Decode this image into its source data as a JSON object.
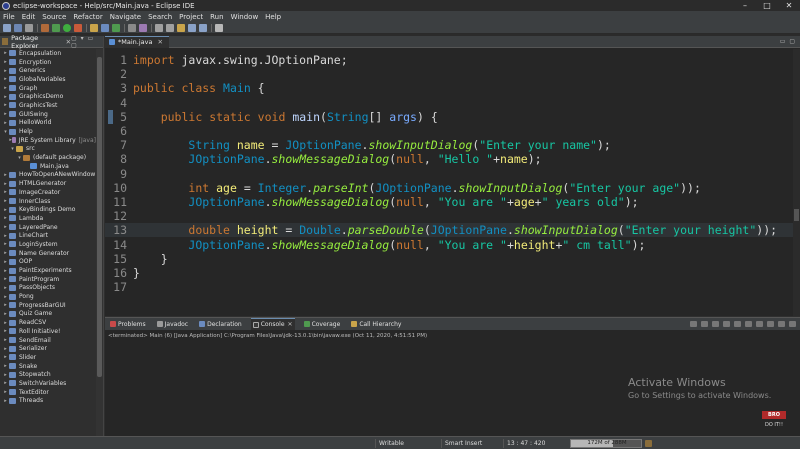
{
  "window": {
    "title": "eclipse-workspace - Help/src/Main.java - Eclipse IDE",
    "controls": [
      "–",
      "□",
      "✕"
    ]
  },
  "menu": [
    "File",
    "Edit",
    "Source",
    "Refactor",
    "Navigate",
    "Search",
    "Project",
    "Run",
    "Window",
    "Help"
  ],
  "package_explorer": {
    "title": "Package Explorer",
    "close": "✕",
    "tree": [
      {
        "label": "Encapsulation",
        "indent": 0,
        "arrow": "▸",
        "kind": "project"
      },
      {
        "label": "Encryption",
        "indent": 0,
        "arrow": "▸",
        "kind": "project"
      },
      {
        "label": "Generics",
        "indent": 0,
        "arrow": "▸",
        "kind": "project"
      },
      {
        "label": "GlobalVariables",
        "indent": 0,
        "arrow": "▸",
        "kind": "project"
      },
      {
        "label": "Graph",
        "indent": 0,
        "arrow": "▸",
        "kind": "project"
      },
      {
        "label": "GraphicsDemo",
        "indent": 0,
        "arrow": "▸",
        "kind": "project"
      },
      {
        "label": "GraphicsTest",
        "indent": 0,
        "arrow": "▸",
        "kind": "project"
      },
      {
        "label": "GUISwing",
        "indent": 0,
        "arrow": "▸",
        "kind": "project"
      },
      {
        "label": "HelloWorld",
        "indent": 0,
        "arrow": "▸",
        "kind": "project"
      },
      {
        "label": "Help",
        "indent": 0,
        "arrow": "▾",
        "kind": "project"
      },
      {
        "label": "JRE System Library",
        "sub": "[Java]",
        "indent": 1,
        "arrow": "▸",
        "kind": "library"
      },
      {
        "label": "src",
        "indent": 1,
        "arrow": "▾",
        "kind": "folder"
      },
      {
        "label": "(default package)",
        "indent": 2,
        "arrow": "▾",
        "kind": "package"
      },
      {
        "label": "Main.java",
        "indent": 3,
        "arrow": "",
        "kind": "java"
      },
      {
        "label": "HowToOpenANewWindow",
        "indent": 0,
        "arrow": "▸",
        "kind": "project"
      },
      {
        "label": "HTMLGenerator",
        "indent": 0,
        "arrow": "▸",
        "kind": "project"
      },
      {
        "label": "ImageCreator",
        "indent": 0,
        "arrow": "▸",
        "kind": "project"
      },
      {
        "label": "InnerClass",
        "indent": 0,
        "arrow": "▸",
        "kind": "project"
      },
      {
        "label": "KeyBindings Demo",
        "indent": 0,
        "arrow": "▸",
        "kind": "project"
      },
      {
        "label": "Lambda",
        "indent": 0,
        "arrow": "▸",
        "kind": "project"
      },
      {
        "label": "LayeredPane",
        "indent": 0,
        "arrow": "▸",
        "kind": "project"
      },
      {
        "label": "LineChart",
        "indent": 0,
        "arrow": "▸",
        "kind": "project"
      },
      {
        "label": "LoginSystem",
        "indent": 0,
        "arrow": "▸",
        "kind": "project"
      },
      {
        "label": "Name Generator",
        "indent": 0,
        "arrow": "▸",
        "kind": "project"
      },
      {
        "label": "OOP",
        "indent": 0,
        "arrow": "▸",
        "kind": "project"
      },
      {
        "label": "PaintExperiments",
        "indent": 0,
        "arrow": "▸",
        "kind": "project"
      },
      {
        "label": "PaintProgram",
        "indent": 0,
        "arrow": "▸",
        "kind": "project"
      },
      {
        "label": "PassObjects",
        "indent": 0,
        "arrow": "▸",
        "kind": "project"
      },
      {
        "label": "Pong",
        "indent": 0,
        "arrow": "▸",
        "kind": "project"
      },
      {
        "label": "ProgressBarGUI",
        "indent": 0,
        "arrow": "▸",
        "kind": "project"
      },
      {
        "label": "Quiz Game",
        "indent": 0,
        "arrow": "▸",
        "kind": "project"
      },
      {
        "label": "ReadCSV",
        "indent": 0,
        "arrow": "▸",
        "kind": "project"
      },
      {
        "label": "Roll Initiative!",
        "indent": 0,
        "arrow": "▸",
        "kind": "project"
      },
      {
        "label": "SendEmail",
        "indent": 0,
        "arrow": "▸",
        "kind": "project"
      },
      {
        "label": "Serializer",
        "indent": 0,
        "arrow": "▸",
        "kind": "project"
      },
      {
        "label": "Slider",
        "indent": 0,
        "arrow": "▸",
        "kind": "project"
      },
      {
        "label": "Snake",
        "indent": 0,
        "arrow": "▸",
        "kind": "project"
      },
      {
        "label": "Stopwatch",
        "indent": 0,
        "arrow": "▸",
        "kind": "project"
      },
      {
        "label": "SwitchVariables",
        "indent": 0,
        "arrow": "▸",
        "kind": "project"
      },
      {
        "label": "TextEditor",
        "indent": 0,
        "arrow": "▸",
        "kind": "project"
      },
      {
        "label": "Threads",
        "indent": 0,
        "arrow": "▸",
        "kind": "project"
      }
    ]
  },
  "editor": {
    "tab_label": "*Main.java",
    "tab_close": "✕",
    "current_line": 13,
    "lines": [
      {
        "n": "1",
        "tokens": [
          [
            "kw",
            "import"
          ],
          [
            "pl",
            " javax.swing.JOptionPane;"
          ]
        ]
      },
      {
        "n": "2",
        "tokens": []
      },
      {
        "n": "3",
        "tokens": [
          [
            "kw",
            "public"
          ],
          [
            "pl",
            " "
          ],
          [
            "kw",
            "class"
          ],
          [
            "pl",
            " "
          ],
          [
            "cl",
            "Main"
          ],
          [
            "pl",
            " {"
          ]
        ]
      },
      {
        "n": "4",
        "tokens": []
      },
      {
        "n": "5",
        "tokens": [
          [
            "pl",
            "    "
          ],
          [
            "kw",
            "public"
          ],
          [
            "pl",
            " "
          ],
          [
            "kw",
            "static"
          ],
          [
            "pl",
            " "
          ],
          [
            "kw",
            "void"
          ],
          [
            "pl",
            " "
          ],
          [
            "fn",
            "main"
          ],
          [
            "pl",
            "("
          ],
          [
            "cl",
            "String"
          ],
          [
            "pl",
            "[] "
          ],
          [
            "vb",
            "args"
          ],
          [
            "pl",
            ") {"
          ]
        ]
      },
      {
        "n": "6",
        "tokens": []
      },
      {
        "n": "7",
        "tokens": [
          [
            "pl",
            "        "
          ],
          [
            "cl",
            "String"
          ],
          [
            "pl",
            " "
          ],
          [
            "va",
            "name"
          ],
          [
            "pl",
            " = "
          ],
          [
            "cl",
            "JOptionPane"
          ],
          [
            "pl",
            "."
          ],
          [
            "mi",
            "showInputDialog"
          ],
          [
            "pl",
            "("
          ],
          [
            "st",
            "\"Enter your name\""
          ],
          [
            "pl",
            ");"
          ]
        ]
      },
      {
        "n": "8",
        "tokens": [
          [
            "pl",
            "        "
          ],
          [
            "cl",
            "JOptionPane"
          ],
          [
            "pl",
            "."
          ],
          [
            "mi",
            "showMessageDialog"
          ],
          [
            "pl",
            "("
          ],
          [
            "kw",
            "null"
          ],
          [
            "pl",
            ", "
          ],
          [
            "st",
            "\"Hello \""
          ],
          [
            "pl",
            "+"
          ],
          [
            "va",
            "name"
          ],
          [
            "pl",
            ");"
          ]
        ]
      },
      {
        "n": "9",
        "tokens": []
      },
      {
        "n": "10",
        "tokens": [
          [
            "pl",
            "        "
          ],
          [
            "kw",
            "int"
          ],
          [
            "pl",
            " "
          ],
          [
            "va",
            "age"
          ],
          [
            "pl",
            " = "
          ],
          [
            "cl",
            "Integer"
          ],
          [
            "pl",
            "."
          ],
          [
            "mi",
            "parseInt"
          ],
          [
            "pl",
            "("
          ],
          [
            "cl",
            "JOptionPane"
          ],
          [
            "pl",
            "."
          ],
          [
            "mi",
            "showInputDialog"
          ],
          [
            "pl",
            "("
          ],
          [
            "st",
            "\"Enter your age\""
          ],
          [
            "pl",
            "));"
          ]
        ]
      },
      {
        "n": "11",
        "tokens": [
          [
            "pl",
            "        "
          ],
          [
            "cl",
            "JOptionPane"
          ],
          [
            "pl",
            "."
          ],
          [
            "mi",
            "showMessageDialog"
          ],
          [
            "pl",
            "("
          ],
          [
            "kw",
            "null"
          ],
          [
            "pl",
            ", "
          ],
          [
            "st",
            "\"You are \""
          ],
          [
            "pl",
            "+"
          ],
          [
            "va",
            "age"
          ],
          [
            "pl",
            "+"
          ],
          [
            "st",
            "\" years old\""
          ],
          [
            "pl",
            ");"
          ]
        ]
      },
      {
        "n": "12",
        "tokens": []
      },
      {
        "n": "13",
        "tokens": [
          [
            "pl",
            "        "
          ],
          [
            "kw",
            "double"
          ],
          [
            "pl",
            " "
          ],
          [
            "va",
            "height"
          ],
          [
            "pl",
            " = "
          ],
          [
            "cl",
            "Double"
          ],
          [
            "pl",
            "."
          ],
          [
            "mi",
            "parseDouble"
          ],
          [
            "pl",
            "("
          ],
          [
            "cl",
            "JOptionPane"
          ],
          [
            "pl",
            "."
          ],
          [
            "mi",
            "showInputDialog"
          ],
          [
            "pl",
            "("
          ],
          [
            "st",
            "\"Enter your height\""
          ],
          [
            "pl",
            "));"
          ]
        ]
      },
      {
        "n": "14",
        "tokens": [
          [
            "pl",
            "        "
          ],
          [
            "cl",
            "JOptionPane"
          ],
          [
            "pl",
            "."
          ],
          [
            "mi",
            "showMessageDialog"
          ],
          [
            "pl",
            "("
          ],
          [
            "kw",
            "null"
          ],
          [
            "pl",
            ", "
          ],
          [
            "st",
            "\"You are \""
          ],
          [
            "pl",
            "+"
          ],
          [
            "va",
            "height"
          ],
          [
            "pl",
            "+"
          ],
          [
            "st",
            "\" cm tall\""
          ],
          [
            "pl",
            ");"
          ]
        ]
      },
      {
        "n": "15",
        "tokens": [
          [
            "pl",
            "    }"
          ]
        ]
      },
      {
        "n": "16",
        "tokens": [
          [
            "pl",
            "}"
          ]
        ]
      },
      {
        "n": "17",
        "tokens": []
      }
    ]
  },
  "bottom_panel": {
    "tabs": [
      {
        "label": "Problems",
        "name": "problems",
        "color": "#c94a4a"
      },
      {
        "label": "Javadoc",
        "name": "javadoc",
        "color": "#9a9a9a"
      },
      {
        "label": "Declaration",
        "name": "declaration",
        "color": "#6b8bbf"
      },
      {
        "label": "Console",
        "name": "console",
        "color": "#3a3a3a",
        "active": true
      },
      {
        "label": "Coverage",
        "name": "coverage",
        "color": "#4f9a4f"
      },
      {
        "label": "Call Hierarchy",
        "name": "call-hierarchy",
        "color": "#c9a44a"
      }
    ],
    "console_text": "<terminated> Main (6) [Java Application] C:\\Program Files\\Java\\jdk-13.0.1\\bin\\javaw.exe (Oct 11, 2020, 4:51:51 PM)"
  },
  "watermark": {
    "line1": "Activate Windows",
    "line2": "Go to Settings to activate Windows."
  },
  "logo": {
    "top": "BRO",
    "bottom": "DO IT!!"
  },
  "status": {
    "writable": "Writable",
    "insert_mode": "Smart Insert",
    "position": "13 : 47 : 420",
    "heap_label": "172M of 288M",
    "heap_fraction": 0.6
  }
}
